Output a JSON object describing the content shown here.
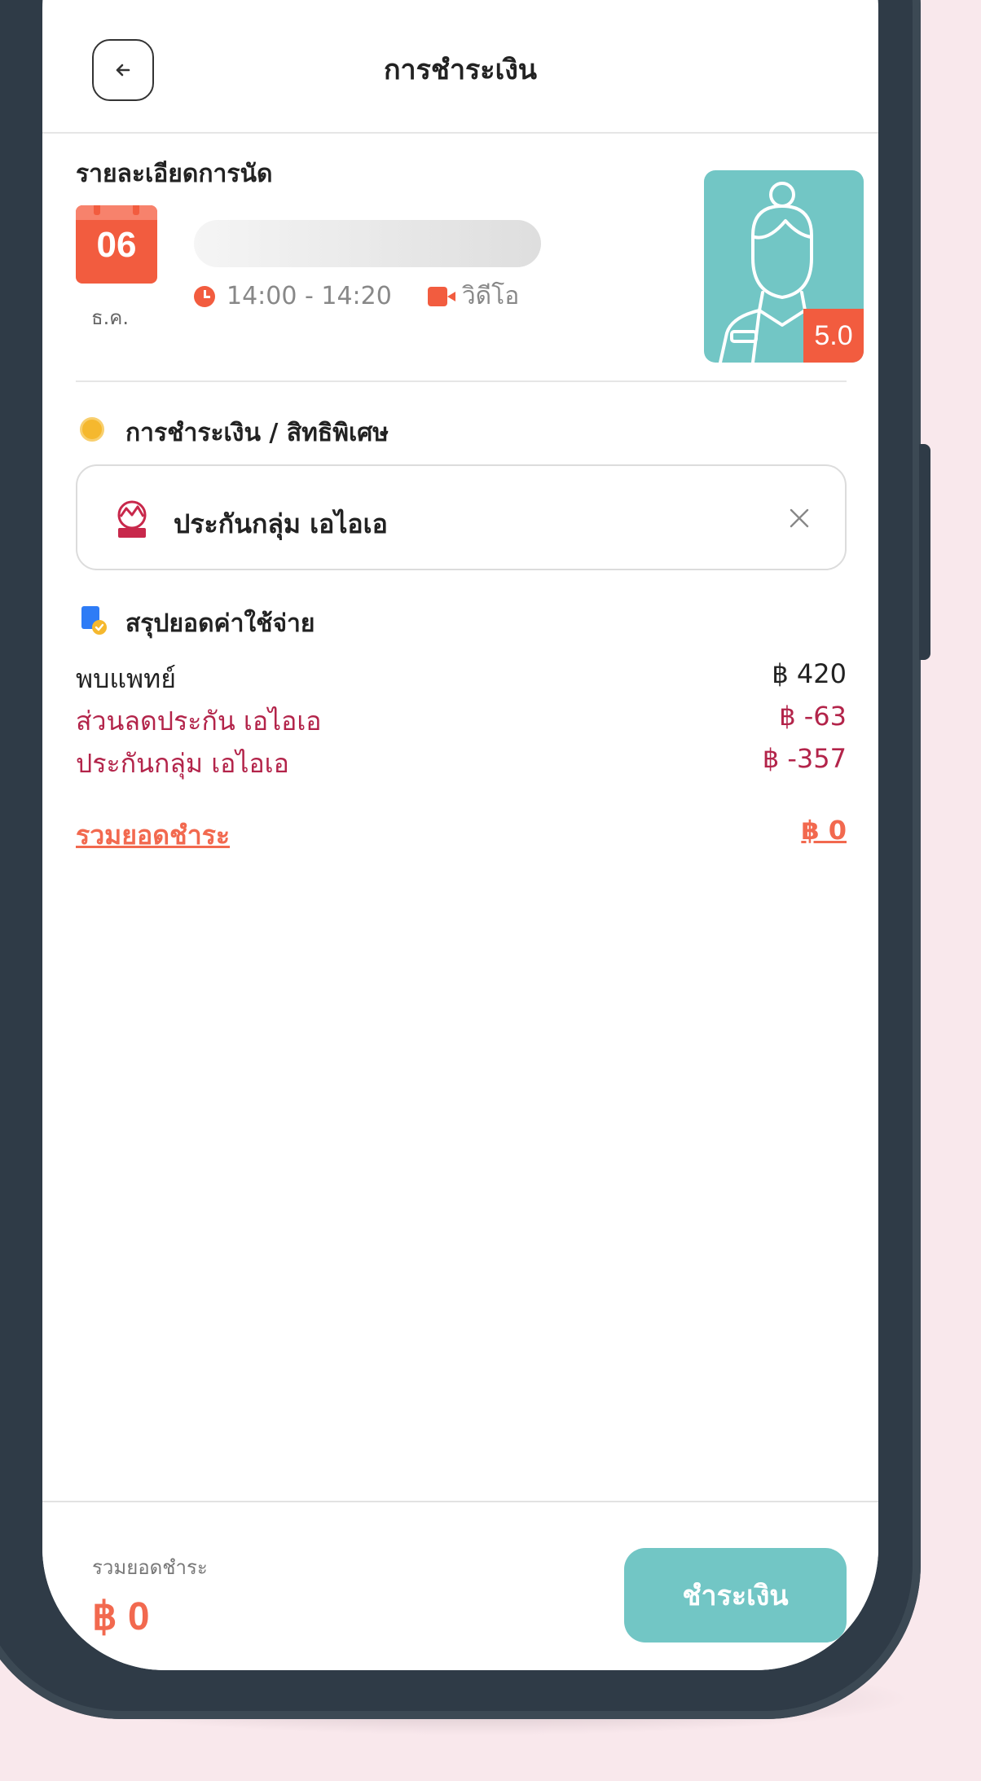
{
  "header": {
    "title": "การชำระเงิน",
    "back_icon": "arrow-left-icon"
  },
  "appointment": {
    "section_label": "รายละเอียดการนัด",
    "day": "06",
    "month": "ธ.ค.",
    "time": "14:00 - 14:20",
    "type": "วิดีโอ",
    "doctor_rating": "5.0"
  },
  "payment": {
    "section_label": "การชำระเงิน / สิทธิพิเศษ",
    "method_name": "ประกันกลุ่ม เอไอเอ",
    "close_icon": "close-icon"
  },
  "summary": {
    "section_label": "สรุปยอดค่าใช้จ่าย",
    "rows": [
      {
        "label": "พบแพทย์",
        "amount": "฿ 420",
        "kind": "normal"
      },
      {
        "label": "ส่วนลดประกัน เอไอเอ",
        "amount": "฿ -63",
        "kind": "discount"
      },
      {
        "label": "ประกันกลุ่ม เอไอเอ",
        "amount": "฿ -357",
        "kind": "discount"
      }
    ],
    "total_label": "รวมยอดชำระ",
    "total_amount": "฿ 0"
  },
  "footer": {
    "total_label": "รวมยอดชำระ",
    "total_amount": "฿ 0",
    "pay_button": "ชำระเงิน"
  },
  "colors": {
    "accent": "#72c6c5",
    "orange": "#f25c3f",
    "discount": "#b3244a",
    "total": "#f2694f"
  }
}
